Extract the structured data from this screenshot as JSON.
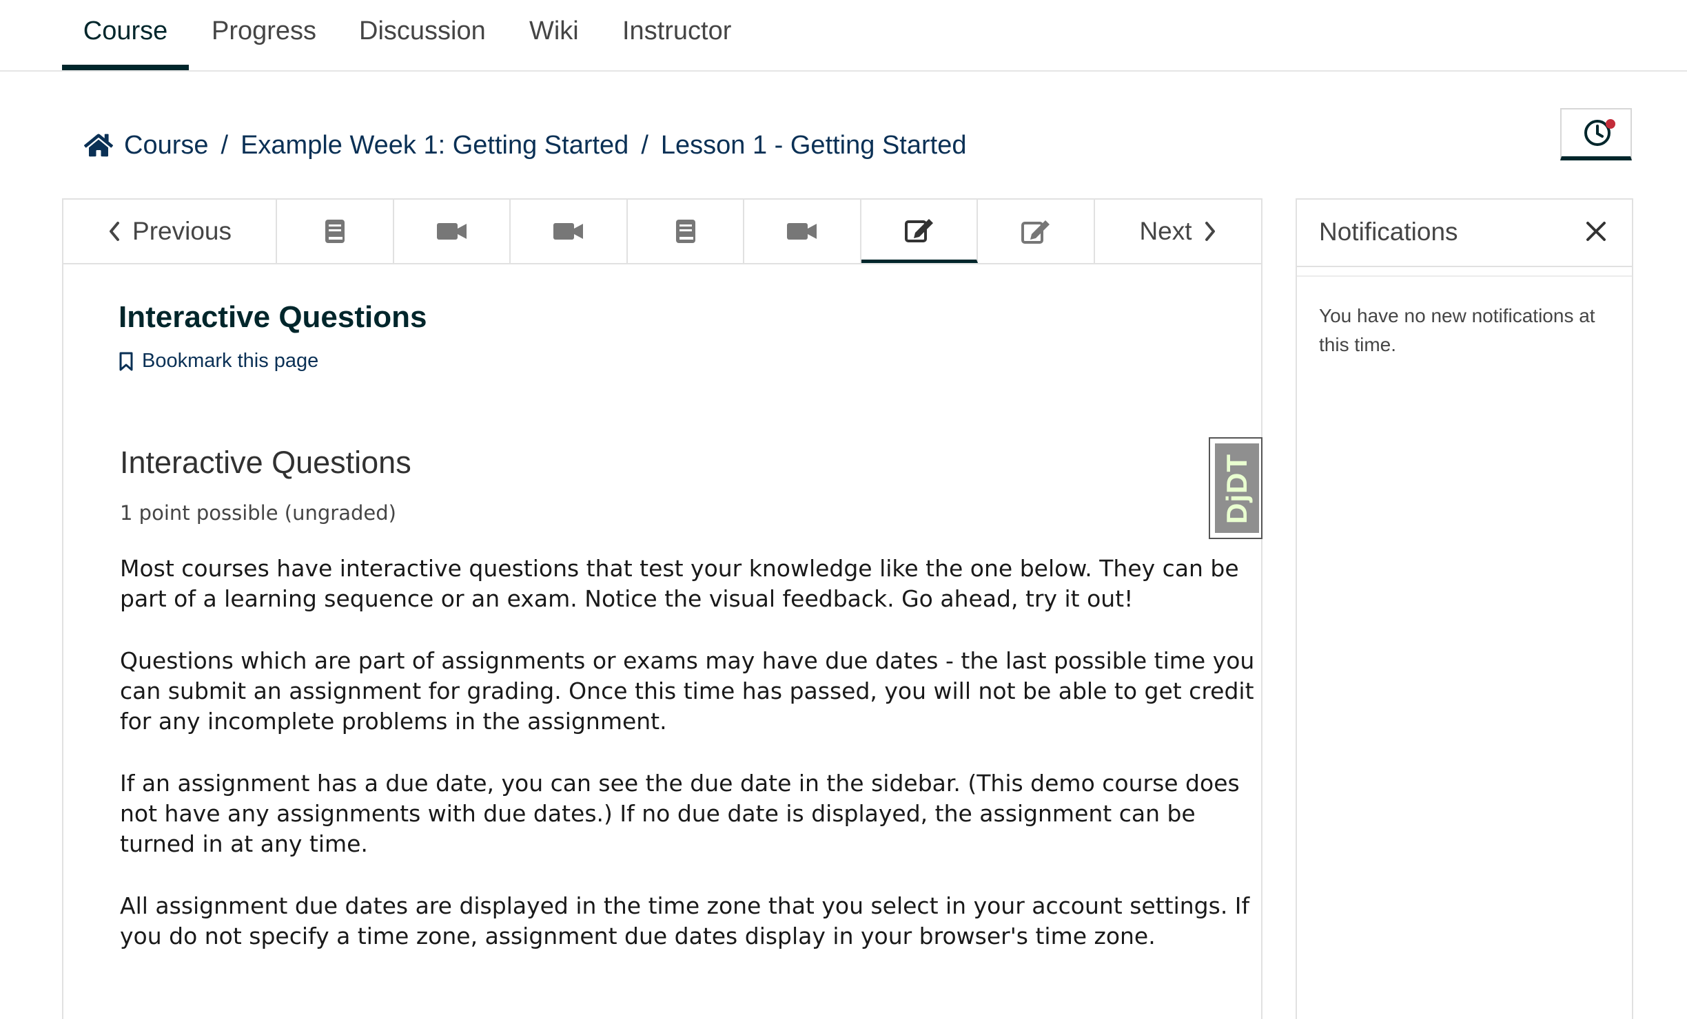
{
  "course_tabs": [
    {
      "label": "Course",
      "active": true
    },
    {
      "label": "Progress",
      "active": false
    },
    {
      "label": "Discussion",
      "active": false
    },
    {
      "label": "Wiki",
      "active": false
    },
    {
      "label": "Instructor",
      "active": false
    }
  ],
  "breadcrumb": {
    "items": [
      "Course",
      "Example Week 1: Getting Started",
      "Lesson 1 - Getting Started"
    ],
    "separator": "/"
  },
  "sequence_nav": {
    "previous_label": "Previous",
    "next_label": "Next",
    "units": [
      {
        "icon": "book-icon"
      },
      {
        "icon": "video-icon"
      },
      {
        "icon": "video-icon"
      },
      {
        "icon": "book-icon"
      },
      {
        "icon": "video-icon"
      },
      {
        "icon": "edit-icon",
        "active": true
      },
      {
        "icon": "edit-icon"
      }
    ]
  },
  "unit": {
    "title": "Interactive Questions",
    "bookmark_label": "Bookmark this page"
  },
  "problem": {
    "title": "Interactive Questions",
    "points": "1 point possible (ungraded)",
    "paragraphs": [
      "Most courses have interactive questions that test your knowledge like the one below. They can be part of a learning sequence or an exam. Notice the visual feedback. Go ahead, try it out!",
      "Questions which are part of assignments or exams may have due dates - the last possible time you can submit an assignment for grading. Once this time has passed, you will not be able to get credit for any incomplete problems in the assignment.",
      "If an assignment has a due date, you can see the due date in the sidebar. (This demo course does not have any assignments with due dates.) If no due date is displayed, the assignment can be turned in at any time.",
      "All assignment due dates are displayed in the time zone that you select in your account settings. If you do not specify a time zone, assignment due dates display in your browser's time zone."
    ]
  },
  "debug_toolbar": {
    "label": "DjDT"
  },
  "notifications": {
    "title": "Notifications",
    "empty_message": "You have no new notifications at this time."
  },
  "colors": {
    "brand_dark": "#00262b",
    "link": "#0a3055",
    "notification_dot": "#c32d3a"
  }
}
